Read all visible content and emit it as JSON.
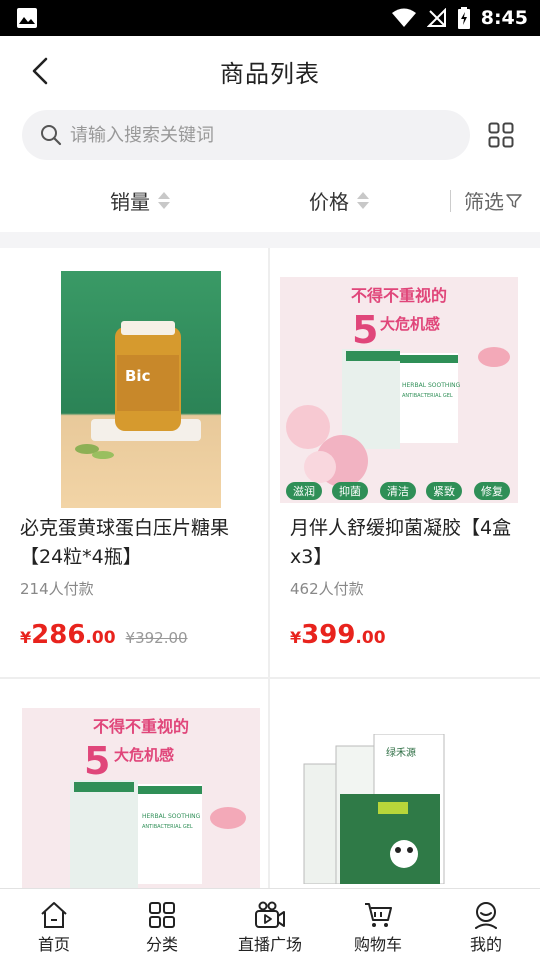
{
  "status_bar": {
    "time": "8:45"
  },
  "header": {
    "title": "商品列表"
  },
  "search": {
    "placeholder": "请输入搜索关键词"
  },
  "sort": {
    "sales_label": "销量",
    "price_label": "价格",
    "filter_label": "筛选"
  },
  "products": [
    {
      "name": "必克蛋黄球蛋白压片糖果【24粒*4瓶】",
      "sold": "214人付款",
      "price_symbol": "¥",
      "price_int": "286",
      "price_dec": ".00",
      "original_price": "¥392.00",
      "image_label": "Bic"
    },
    {
      "name": "月伴人舒缓抑菌凝胶【4盒x3】",
      "sold": "462人付款",
      "price_symbol": "¥",
      "price_int": "399",
      "price_dec": ".00",
      "image": {
        "headline": "不得不重视的",
        "big_num": "5",
        "headline2": "大危机感",
        "box_title": "HERBAL SOOTHING",
        "box_sub": "ANTIBACTERIAL GEL",
        "tags": [
          "滋润",
          "抑菌",
          "清洁",
          "紧致",
          "修复"
        ]
      }
    },
    {
      "image": {
        "headline": "不得不重视的",
        "big_num": "5",
        "headline2": "大危机感",
        "box_title": "HERBAL SOOTHING",
        "box_sub": "ANTIBACTERIAL GEL"
      }
    },
    {
      "image_label": "绿禾源"
    }
  ],
  "bottom_nav": [
    {
      "label": "首页",
      "icon": "home-icon"
    },
    {
      "label": "分类",
      "icon": "category-icon"
    },
    {
      "label": "直播广场",
      "icon": "live-icon"
    },
    {
      "label": "购物车",
      "icon": "cart-icon"
    },
    {
      "label": "我的",
      "icon": "profile-icon"
    }
  ],
  "colors": {
    "price": "#e8231d",
    "tag_green": "#2f8f57",
    "headline_pink": "#e0467a"
  }
}
